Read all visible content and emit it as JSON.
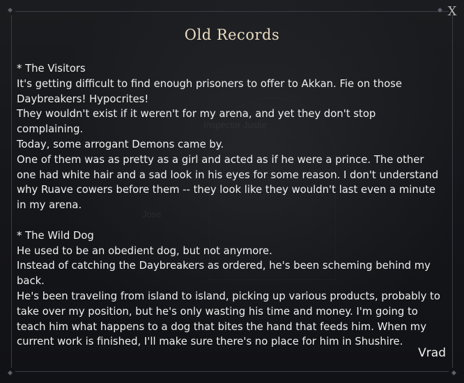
{
  "dialog": {
    "title": "Old Records",
    "close_label": "X",
    "background_hints": [
      "Inspector Justie",
      "Jose"
    ],
    "entries": [
      {
        "heading": "* The Visitors",
        "lines": [
          "It's getting difficult to find enough prisoners to offer to Akkan. Fie on those Daybreakers! Hypocrites!",
          "They wouldn't exist if it weren't for my arena, and yet they don't stop complaining.",
          "Today, some arrogant Demons came by.",
          "One of them was as pretty as a girl and acted as if he were a prince. The other one had white hair and a sad look in his eyes for some reason. I don't understand why Ruave cowers before them -- they look like they wouldn't last even a minute in my arena."
        ]
      },
      {
        "heading": "* The Wild Dog",
        "lines": [
          "He used to be an obedient dog, but not anymore.",
          "Instead of catching the Daybreakers as ordered, he's been scheming behind my back.",
          "He's been traveling from island to island, picking up various products, probably to take over my position, but he's only wasting his time and money. I'm going to teach him what happens to a dog that bites the hand that feeds him. When my current work is finished, I'll make sure there's no place for him in Shushire."
        ]
      }
    ],
    "signature": "Vrad"
  }
}
